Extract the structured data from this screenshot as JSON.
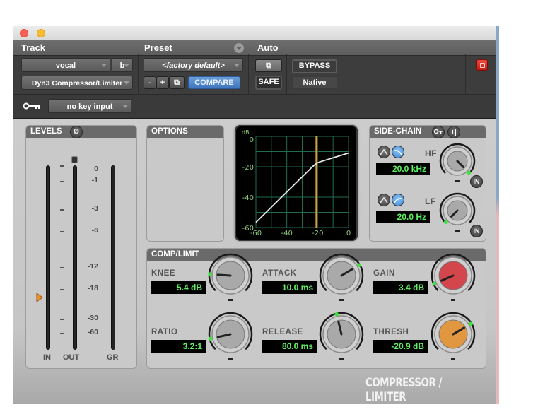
{
  "window": {
    "controls": [
      "close",
      "minimize"
    ]
  },
  "header": {
    "track_label": "Track",
    "preset_label": "Preset",
    "auto_label": "Auto",
    "track_name": "vocal",
    "track_channel": "b",
    "plugin_name": "Dyn3 Compressor/Limiter",
    "preset_value": "<factory default>",
    "preset_minus": "-",
    "preset_plus": "+",
    "compare_label": "COMPARE",
    "safe_label": "SAFE",
    "bypass_label": "BYPASS",
    "native_label": "Native",
    "key_input": "no key input"
  },
  "levels": {
    "title": "LEVELS",
    "phase_icon": "Ø",
    "scale": [
      "0",
      "-1",
      "-3",
      "-6",
      "-12",
      "-18",
      "-30",
      "-60"
    ],
    "meters": [
      "IN",
      "OUT",
      "GR"
    ],
    "threshold_marker_db": -20.9
  },
  "options": {
    "title": "OPTIONS"
  },
  "graph": {
    "unit_label": "dB",
    "y_ticks": [
      "0",
      "-20",
      "-40",
      "-60"
    ],
    "x_ticks": [
      "-60",
      "-40",
      "-20",
      "0"
    ],
    "threshold_db": -20.9,
    "ratio": 3.2,
    "knee_db": 5.4,
    "gain_db": 3.4,
    "colors": {
      "grid": "#1f6b55",
      "curve": "#e8e8e8",
      "threshold": "#f0962a",
      "labels": "#8fc87a"
    }
  },
  "sidechain": {
    "title": "SIDE-CHAIN",
    "key_icon": "key-listen",
    "hf_label": "HF",
    "hf_value": "20.0 kHz",
    "lf_label": "LF",
    "lf_value": "20.0 Hz",
    "in_label": "IN"
  },
  "comp": {
    "title": "COMP/LIMIT",
    "knee_label": "KNEE",
    "knee_value": "5.4 dB",
    "ratio_label": "RATIO",
    "ratio_value": "3.2:1",
    "attack_label": "ATTACK",
    "attack_value": "10.0 ms",
    "release_label": "RELEASE",
    "release_value": "80.0 ms",
    "gain_label": "GAIN",
    "gain_value": "3.4 dB",
    "thresh_label": "THRESH",
    "thresh_value": "-20.9 dB"
  },
  "brand": "COMPRESSOR / LIMITER",
  "knobs": {
    "hf": 1.0,
    "lf": 0.0,
    "knee": 0.18,
    "ratio": 0.12,
    "attack": 0.72,
    "release": 0.45,
    "gain": 0.08,
    "thresh": 0.72
  }
}
